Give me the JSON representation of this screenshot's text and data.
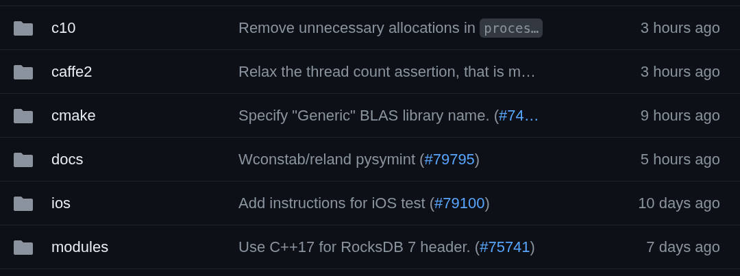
{
  "rows": [
    {
      "name": "c10",
      "message": [
        {
          "kind": "text",
          "text": "Remove unnecessary allocations in "
        },
        {
          "kind": "code",
          "text": "proces…"
        }
      ],
      "time": "3 hours ago"
    },
    {
      "name": "caffe2",
      "message": [
        {
          "kind": "text",
          "text": "Relax the thread count assertion, that is m…"
        }
      ],
      "time": "3 hours ago"
    },
    {
      "name": "cmake",
      "message": [
        {
          "kind": "text",
          "text": "Specify \"Generic\" BLAS library name. ("
        },
        {
          "kind": "link",
          "text": "#74…"
        }
      ],
      "time": "9 hours ago"
    },
    {
      "name": "docs",
      "message": [
        {
          "kind": "text",
          "text": "Wconstab/reland pysymint ("
        },
        {
          "kind": "link",
          "text": "#79795"
        },
        {
          "kind": "text",
          "text": ")"
        }
      ],
      "time": "5 hours ago"
    },
    {
      "name": "ios",
      "message": [
        {
          "kind": "text",
          "text": "Add instructions for iOS test ("
        },
        {
          "kind": "link",
          "text": "#79100"
        },
        {
          "kind": "text",
          "text": ")"
        }
      ],
      "time": "10 days ago"
    },
    {
      "name": "modules",
      "message": [
        {
          "kind": "text",
          "text": "Use C++17 for RocksDB 7 header. ("
        },
        {
          "kind": "link",
          "text": "#75741"
        },
        {
          "kind": "text",
          "text": ")"
        }
      ],
      "time": "7 days ago"
    }
  ]
}
